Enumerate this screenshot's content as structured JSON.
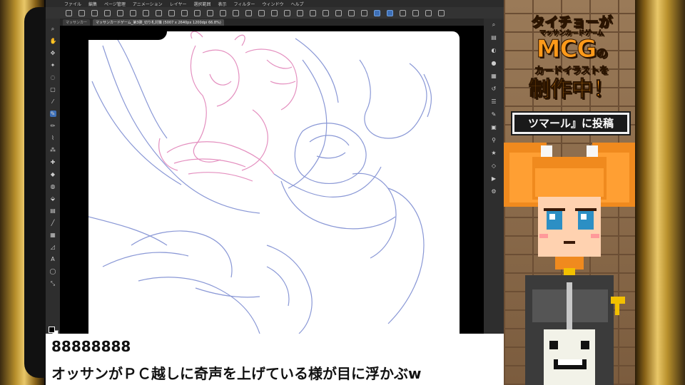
{
  "app": {
    "menu": [
      "ファイル",
      "編集",
      "ページ管理",
      "アニメーション",
      "レイヤー",
      "選択範囲",
      "表示",
      "フィルター",
      "ウィンドウ",
      "ヘルプ"
    ],
    "tabs": [
      {
        "label": "マッサンカー",
        "active": false
      },
      {
        "label": "マッサンカードゲーム_第3弾_切り札対策 (5007 x 2640px 1200dpi 66.8%)",
        "active": true
      }
    ]
  },
  "side_panel": {
    "title_lines": [
      "タイチョーが",
      "マッサンカードゲーム",
      "MCG",
      "カードイラストを",
      "制作中！"
    ],
    "title_line3_suffix": "の",
    "notice": "ツマール』に投稿"
  },
  "chat": {
    "username": "88888888",
    "message": "オッサンがＰＣ越しに奇声を上げている様が目に浮かぶw"
  },
  "colors": {
    "accent": "#ff9a1a",
    "frame_gold": "#e9c768",
    "sketch_blue": "#8a98d6",
    "sketch_pink": "#e48fbf"
  }
}
